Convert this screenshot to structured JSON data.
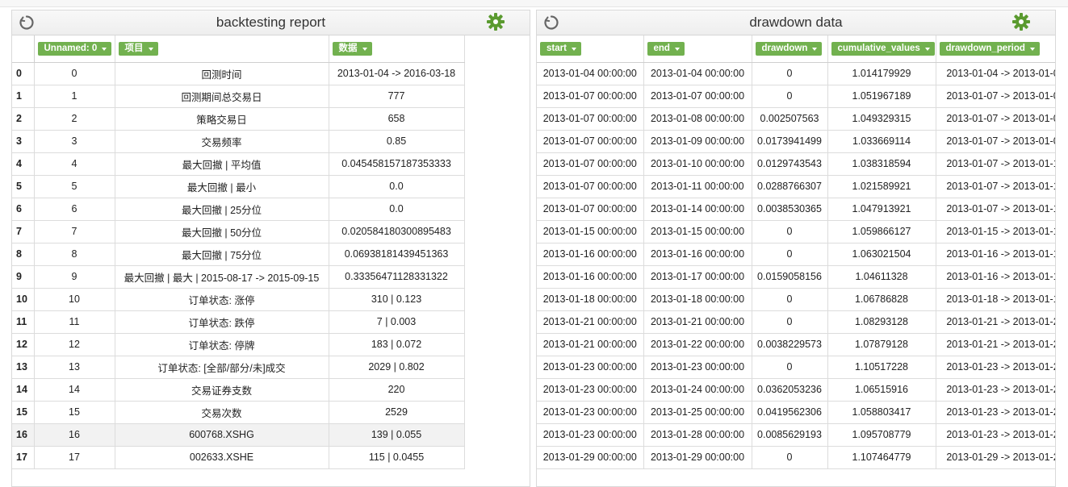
{
  "left_panel": {
    "title": "backtesting report",
    "columns": [
      "Unnamed: 0",
      "项目",
      "数据"
    ],
    "rows": [
      {
        "idx": "0",
        "c0": "0",
        "c1": "回测时间",
        "c2": "2013-01-04 -> 2016-03-18"
      },
      {
        "idx": "1",
        "c0": "1",
        "c1": "回测期间总交易日",
        "c2": "777"
      },
      {
        "idx": "2",
        "c0": "2",
        "c1": "策略交易日",
        "c2": "658"
      },
      {
        "idx": "3",
        "c0": "3",
        "c1": "交易频率",
        "c2": "0.85"
      },
      {
        "idx": "4",
        "c0": "4",
        "c1": "最大回撤 | 平均值",
        "c2": "0.045458157187353333"
      },
      {
        "idx": "5",
        "c0": "5",
        "c1": "最大回撤 | 最小",
        "c2": "0.0"
      },
      {
        "idx": "6",
        "c0": "6",
        "c1": "最大回撤 | 25分位",
        "c2": "0.0"
      },
      {
        "idx": "7",
        "c0": "7",
        "c1": "最大回撤 | 50分位",
        "c2": "0.020584180300895483"
      },
      {
        "idx": "8",
        "c0": "8",
        "c1": "最大回撤 | 75分位",
        "c2": "0.06938181439451363"
      },
      {
        "idx": "9",
        "c0": "9",
        "c1": "最大回撤 | 最大 | 2015-08-17 -> 2015-09-15",
        "c2": "0.33356471128331322"
      },
      {
        "idx": "10",
        "c0": "10",
        "c1": "订单状态: 涨停",
        "c2": "310 | 0.123"
      },
      {
        "idx": "11",
        "c0": "11",
        "c1": "订单状态: 跌停",
        "c2": "7 | 0.003"
      },
      {
        "idx": "12",
        "c0": "12",
        "c1": "订单状态: 停牌",
        "c2": "183 | 0.072"
      },
      {
        "idx": "13",
        "c0": "13",
        "c1": "订单状态: [全部/部分/未]成交",
        "c2": "2029 | 0.802"
      },
      {
        "idx": "14",
        "c0": "14",
        "c1": "交易证券支数",
        "c2": "220"
      },
      {
        "idx": "15",
        "c0": "15",
        "c1": "交易次数",
        "c2": "2529"
      },
      {
        "idx": "16",
        "c0": "16",
        "c1": "600768.XSHG",
        "c2": "139 | 0.055"
      },
      {
        "idx": "17",
        "c0": "17",
        "c1": "002633.XSHE",
        "c2": "115 | 0.0455"
      }
    ]
  },
  "right_panel": {
    "title": "drawdown data",
    "columns": [
      "start",
      "end",
      "drawdown",
      "cumulative_values",
      "drawdown_period"
    ],
    "rows": [
      {
        "c0": "2013-01-04 00:00:00",
        "c1": "2013-01-04 00:00:00",
        "c2": "0",
        "c3": "1.014179929",
        "c4": "2013-01-04 -> 2013-01-0"
      },
      {
        "c0": "2013-01-07 00:00:00",
        "c1": "2013-01-07 00:00:00",
        "c2": "0",
        "c3": "1.051967189",
        "c4": "2013-01-07 -> 2013-01-0"
      },
      {
        "c0": "2013-01-07 00:00:00",
        "c1": "2013-01-08 00:00:00",
        "c2": "0.002507563",
        "c3": "1.049329315",
        "c4": "2013-01-07 -> 2013-01-0"
      },
      {
        "c0": "2013-01-07 00:00:00",
        "c1": "2013-01-09 00:00:00",
        "c2": "0.0173941499",
        "c3": "1.033669114",
        "c4": "2013-01-07 -> 2013-01-0"
      },
      {
        "c0": "2013-01-07 00:00:00",
        "c1": "2013-01-10 00:00:00",
        "c2": "0.0129743543",
        "c3": "1.038318594",
        "c4": "2013-01-07 -> 2013-01-1"
      },
      {
        "c0": "2013-01-07 00:00:00",
        "c1": "2013-01-11 00:00:00",
        "c2": "0.0288766307",
        "c3": "1.021589921",
        "c4": "2013-01-07 -> 2013-01-1"
      },
      {
        "c0": "2013-01-07 00:00:00",
        "c1": "2013-01-14 00:00:00",
        "c2": "0.0038530365",
        "c3": "1.047913921",
        "c4": "2013-01-07 -> 2013-01-1"
      },
      {
        "c0": "2013-01-15 00:00:00",
        "c1": "2013-01-15 00:00:00",
        "c2": "0",
        "c3": "1.059866127",
        "c4": "2013-01-15 -> 2013-01-1"
      },
      {
        "c0": "2013-01-16 00:00:00",
        "c1": "2013-01-16 00:00:00",
        "c2": "0",
        "c3": "1.063021504",
        "c4": "2013-01-16 -> 2013-01-1"
      },
      {
        "c0": "2013-01-16 00:00:00",
        "c1": "2013-01-17 00:00:00",
        "c2": "0.0159058156",
        "c3": "1.04611328",
        "c4": "2013-01-16 -> 2013-01-1"
      },
      {
        "c0": "2013-01-18 00:00:00",
        "c1": "2013-01-18 00:00:00",
        "c2": "0",
        "c3": "1.06786828",
        "c4": "2013-01-18 -> 2013-01-1"
      },
      {
        "c0": "2013-01-21 00:00:00",
        "c1": "2013-01-21 00:00:00",
        "c2": "0",
        "c3": "1.08293128",
        "c4": "2013-01-21 -> 2013-01-2"
      },
      {
        "c0": "2013-01-21 00:00:00",
        "c1": "2013-01-22 00:00:00",
        "c2": "0.0038229573",
        "c3": "1.07879128",
        "c4": "2013-01-21 -> 2013-01-2"
      },
      {
        "c0": "2013-01-23 00:00:00",
        "c1": "2013-01-23 00:00:00",
        "c2": "0",
        "c3": "1.10517228",
        "c4": "2013-01-23 -> 2013-01-2"
      },
      {
        "c0": "2013-01-23 00:00:00",
        "c1": "2013-01-24 00:00:00",
        "c2": "0.0362053236",
        "c3": "1.06515916",
        "c4": "2013-01-23 -> 2013-01-2"
      },
      {
        "c0": "2013-01-23 00:00:00",
        "c1": "2013-01-25 00:00:00",
        "c2": "0.0419562306",
        "c3": "1.058803417",
        "c4": "2013-01-23 -> 2013-01-2"
      },
      {
        "c0": "2013-01-23 00:00:00",
        "c1": "2013-01-28 00:00:00",
        "c2": "0.0085629193",
        "c3": "1.095708779",
        "c4": "2013-01-23 -> 2013-01-2"
      },
      {
        "c0": "2013-01-29 00:00:00",
        "c1": "2013-01-29 00:00:00",
        "c2": "0",
        "c3": "1.107464779",
        "c4": "2013-01-29 -> 2013-01-2"
      }
    ]
  },
  "icons": {
    "refresh": "refresh-icon",
    "settings": "gear-icon",
    "dropdown": "caret-down-icon"
  },
  "colors": {
    "accent": "#72b14f",
    "gear": "#5a9a2f",
    "highlight_row": "#f2f2f2"
  }
}
